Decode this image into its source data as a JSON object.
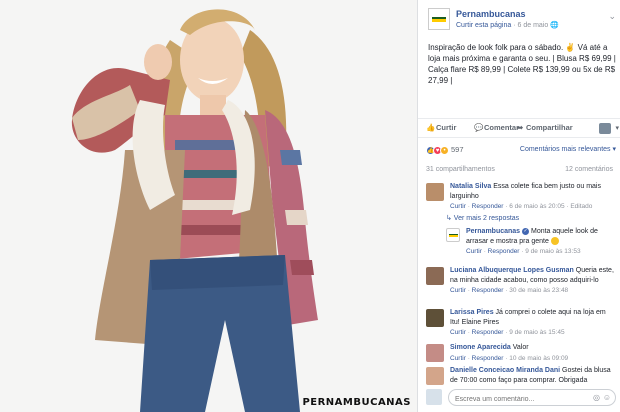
{
  "watermark": "PERNAMBUCANAS",
  "page": {
    "name": "Pernambucanas",
    "follow_label": "Curtir esta página",
    "separator": " · ",
    "date": "6 de maio",
    "globe": "🌐"
  },
  "post": {
    "text": "Inspiração de look folk para o sábado. ✌ Vá até a loja mais próxima e garanta o seu. | Blusa R$ 69,99 | Calça flare R$ 89,99 | Colete R$ 139,99 ou 5x de R$ 27,99 |"
  },
  "actions": {
    "like": "Curtir",
    "comment": "Comentar",
    "share": "Compartilhar",
    "like_icon": "👍",
    "comment_icon": "💬",
    "share_icon": "➦"
  },
  "reactions": {
    "count": "597",
    "sort_label": "Comentários mais relevantes ▾"
  },
  "stats": {
    "shares": "31 compartilhamentos",
    "comments": "12 comentários"
  },
  "comments": [
    {
      "author": "Natalia Silva",
      "text": "Essa colete fica bem justo ou mais larguinho",
      "like": "Curtir",
      "reply": "Responder",
      "time": "6 de maio às 20:05",
      "extra": "Editado"
    },
    {
      "author": "Luciana Albuquerque Lopes Gusman",
      "text": "Queria este, na minha cidade acabou, como posso adquiri-lo",
      "like": "Curtir",
      "reply": "Responder",
      "time": "30 de maio às 23:48"
    },
    {
      "author": "Larissa Pires",
      "text": "Já comprei o colete aqui na loja em Itu! Elaine Pires",
      "like": "Curtir",
      "reply": "Responder",
      "time": "9 de maio às 15:45"
    },
    {
      "author": "Simone Aparecida",
      "text": "Valor",
      "like": "Curtir",
      "reply": "Responder",
      "time": "10 de maio às 09:09"
    },
    {
      "author": "Danielle Conceicao Miranda Dani",
      "text": "Gostei da blusa de 70:00 como faço para comprar. Obrigada"
    }
  ],
  "more_replies": "↳ Ver mais 2 respostas",
  "reply": {
    "author": "Pernambucanas",
    "text": "Monta aquele look de arrasar e mostra pra gente",
    "like": "Curtir",
    "reply": "Responder",
    "time": "9 de maio às 13:53"
  },
  "composer": {
    "placeholder": "Escreva um comentário..."
  },
  "colors": {
    "link": "#365899",
    "brand_yellow": "#ffcc00",
    "brand_green": "#1b5e20"
  }
}
